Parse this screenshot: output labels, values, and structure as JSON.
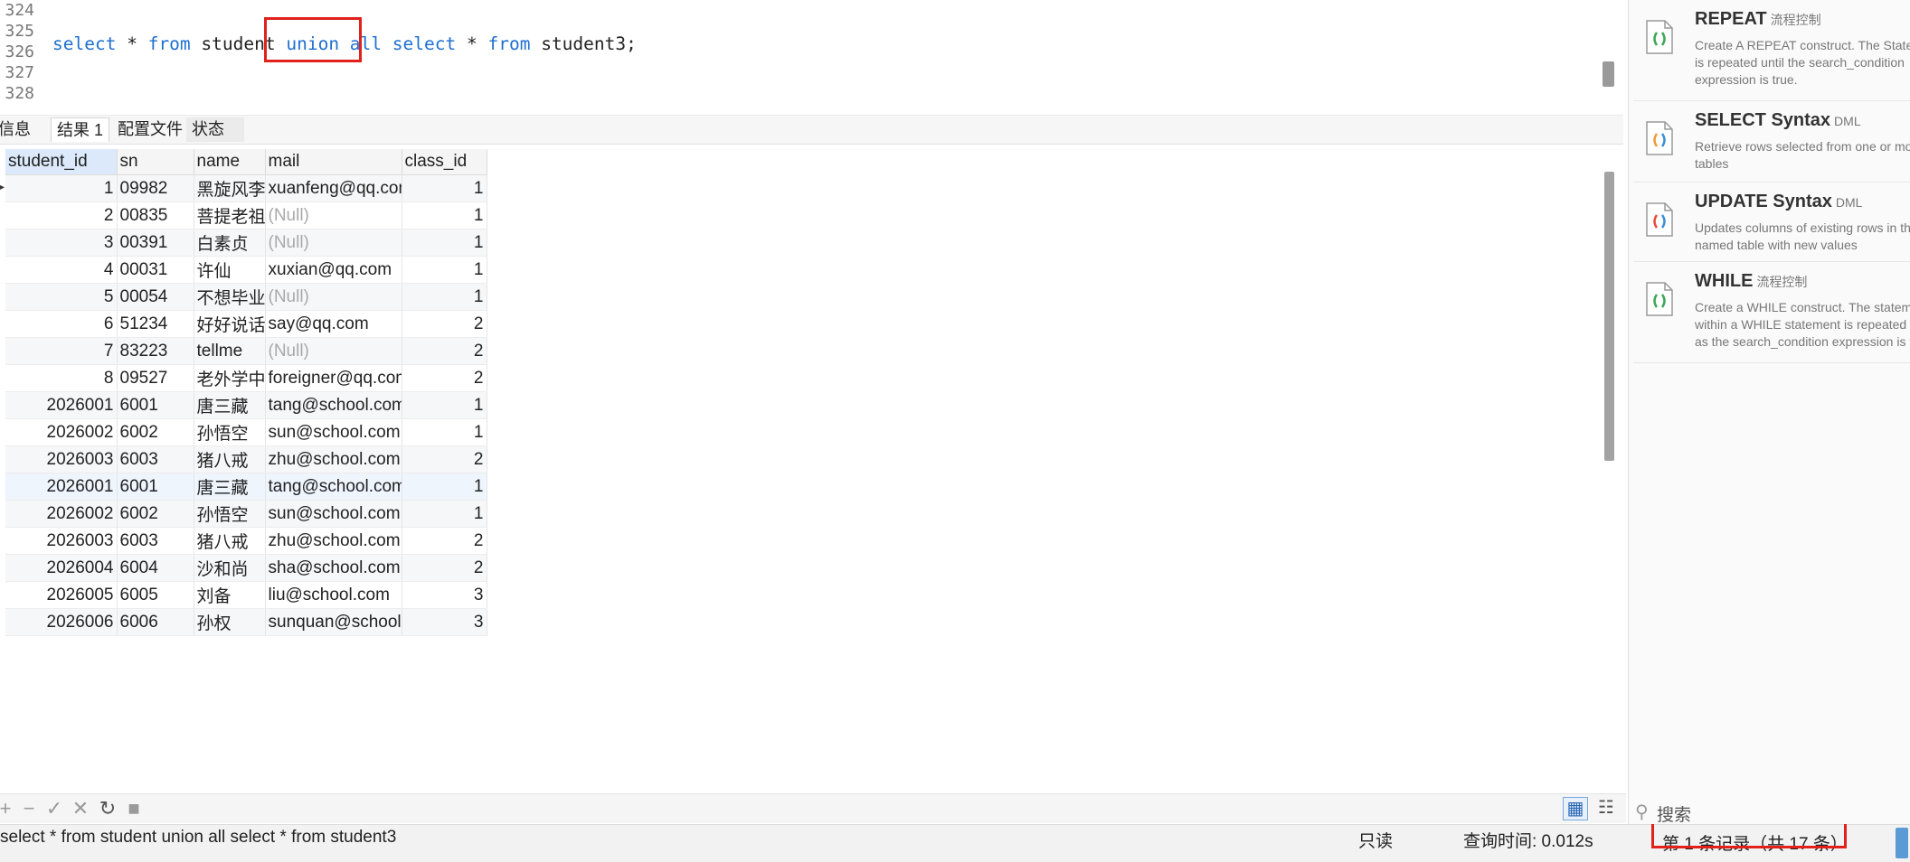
{
  "editor": {
    "line_numbers": [
      "324",
      "325",
      "326",
      "327",
      "328"
    ],
    "code": {
      "kw_select1": "select",
      "star1": "*",
      "kw_from1": "from",
      "table1": "student",
      "kw_union_all": "union all",
      "kw_select2": "select",
      "star2": "*",
      "kw_from2": "from",
      "table2": "student3;"
    }
  },
  "tabs": [
    "信息",
    "结果 1",
    "配置文件",
    "状态"
  ],
  "grid": {
    "columns": [
      "student_id",
      "sn",
      "name",
      "mail",
      "class_id"
    ],
    "null_text": "(Null)",
    "rows": [
      [
        "1",
        "09982",
        "黑旋风李逵",
        "xuanfeng@qq.com",
        "1"
      ],
      [
        "2",
        "00835",
        "菩提老祖",
        null,
        "1"
      ],
      [
        "3",
        "00391",
        "白素贞",
        null,
        "1"
      ],
      [
        "4",
        "00031",
        "许仙",
        "xuxian@qq.com",
        "1"
      ],
      [
        "5",
        "00054",
        "不想毕业",
        null,
        "1"
      ],
      [
        "6",
        "51234",
        "好好说话",
        "say@qq.com",
        "2"
      ],
      [
        "7",
        "83223",
        "tellme",
        null,
        "2"
      ],
      [
        "8",
        "09527",
        "老外学中文",
        "foreigner@qq.com",
        "2"
      ],
      [
        "2026001",
        "6001",
        "唐三藏",
        "tang@school.com",
        "1"
      ],
      [
        "2026002",
        "6002",
        "孙悟空",
        "sun@school.com",
        "1"
      ],
      [
        "2026003",
        "6003",
        "猪八戒",
        "zhu@school.com",
        "2"
      ],
      [
        "2026001",
        "6001",
        "唐三藏",
        "tang@school.com",
        "1"
      ],
      [
        "2026002",
        "6002",
        "孙悟空",
        "sun@school.com",
        "1"
      ],
      [
        "2026003",
        "6003",
        "猪八戒",
        "zhu@school.com",
        "2"
      ],
      [
        "2026004",
        "6004",
        "沙和尚",
        "sha@school.com",
        "2"
      ],
      [
        "2026005",
        "6005",
        "刘备",
        "liu@school.com",
        "3"
      ],
      [
        "2026006",
        "6006",
        "孙权",
        "sunquan@school.com",
        "3"
      ]
    ]
  },
  "toolbar": {
    "icons": [
      "plus-icon",
      "minus-icon",
      "check-icon",
      "x-icon",
      "refresh-icon",
      "stop-icon",
      "grid-view-icon",
      "form-view-icon"
    ]
  },
  "status": {
    "query_text": "select * from student union all select * from student3",
    "readonly": "只读",
    "query_time": "查询时间: 0.012s",
    "record_info": "第 1 条记录（共 17 条）"
  },
  "snippets": [
    {
      "title": "REPEAT",
      "tag": "流程控制",
      "desc": "Create A REPEAT construct. The Statement\nis repeated until the search_condition\nexpression is true.",
      "colors": [
        "#3aa757",
        "#3aa757"
      ]
    },
    {
      "title": "SELECT Syntax",
      "tag": "DML",
      "desc": "Retrieve rows selected from one or more\ntables",
      "colors": [
        "#f29a38",
        "#3b8ed6"
      ]
    },
    {
      "title": "UPDATE Syntax",
      "tag": "DML",
      "desc": "Updates columns of existing rows in the\nnamed table with new values",
      "colors": [
        "#e84b3c",
        "#3b8ed6"
      ]
    },
    {
      "title": "WHILE",
      "tag": "流程控制",
      "desc": "Create a WHILE construct. The statement\nwithin a WHILE statement is repeated as long\nas the search_condition expression is true.",
      "colors": [
        "#3aa757",
        "#3aa757"
      ]
    }
  ],
  "search": {
    "placeholder": "搜索"
  },
  "colors": {
    "keyword": "#1e6fd1",
    "highlight_border": "#e0211c",
    "null_text": "#a9a9a9"
  }
}
